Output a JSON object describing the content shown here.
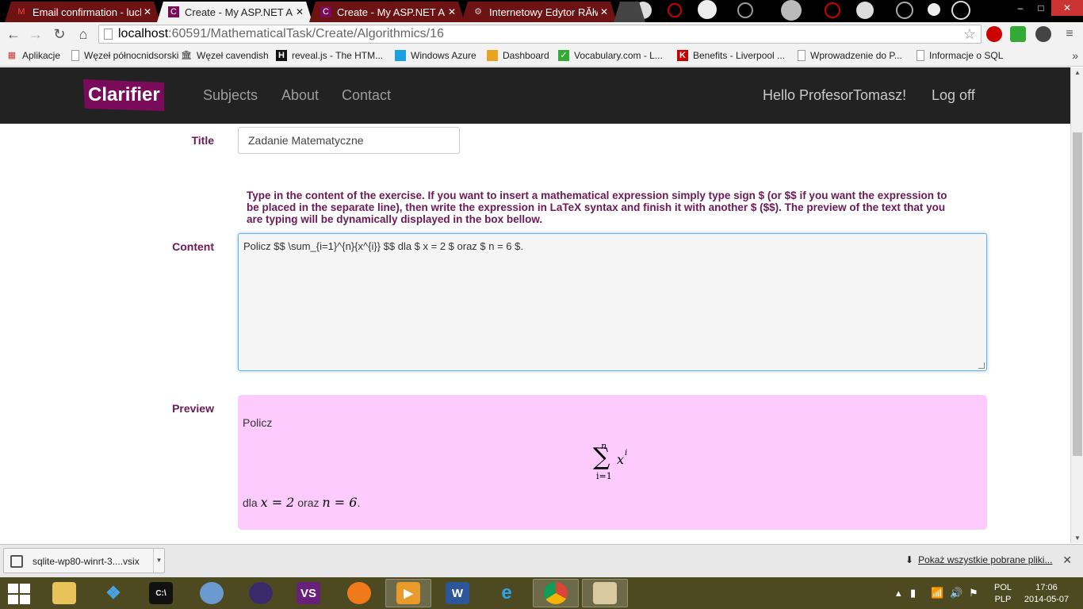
{
  "browser": {
    "tabs": [
      {
        "title": "Email confirmation - luck",
        "icon": "gmail-icon",
        "active": false
      },
      {
        "title": "Create - My ASP.NET App",
        "icon": "app-icon",
        "active": true
      },
      {
        "title": "Create - My ASP.NET App",
        "icon": "app-icon",
        "active": false
      },
      {
        "title": "Internetowy Edytor RĂłwn",
        "icon": "gear-icon",
        "active": false
      }
    ],
    "url_host": "localhost",
    "url_path": ":60591/MathematicalTask/Create/Algorithmics/16",
    "bookmarks": [
      {
        "label": "Aplikacje",
        "icon": "apps-grid-icon"
      },
      {
        "label": "Węzeł północnidsorski",
        "icon": "page-icon"
      },
      {
        "label": "Węzeł cavendish",
        "icon": "building-icon"
      },
      {
        "label": "reveal.js - The HTM...",
        "icon": "h-logo-icon"
      },
      {
        "label": "Windows Azure",
        "icon": "windows-icon"
      },
      {
        "label": "Dashboard",
        "icon": "dashboard-icon"
      },
      {
        "label": "Vocabulary.com - L...",
        "icon": "check-icon"
      },
      {
        "label": "Benefits - Liverpool ...",
        "icon": "k-logo-icon"
      },
      {
        "label": "Wprowadzenie do P...",
        "icon": "page-icon"
      },
      {
        "label": "Informacje o SQL",
        "icon": "page-icon"
      }
    ],
    "bookmarks_more": "»"
  },
  "app": {
    "logo_text": "Clarifier",
    "nav": {
      "subjects": "Subjects",
      "about": "About",
      "contact": "Contact",
      "greeting": "Hello ProfesorTomasz!",
      "logoff": "Log off"
    }
  },
  "form": {
    "title_label": "Title",
    "title_value": "Zadanie Matematyczne",
    "hint": "Type in the content of the exercise. If you want to insert a mathematical expression simply type sign $ (or $$ if you want the expression to be placed in the separate line), then write the expression in LaTeX syntax and finish it with another $ ($$). The preview of the text that you are typing will be dynamically displayed in the box bellow.",
    "content_label": "Content",
    "content_value": "Policz $$ \\sum_{i=1}^{n}{x^{i}} $$ dla $ x = 2 $ oraz $ n = 6 $.",
    "preview_label": "Preview",
    "preview": {
      "line1": "Policz",
      "formula_sum": "∑",
      "formula_upper": "n",
      "formula_lower": "i=1",
      "formula_base": "x",
      "formula_exp": "i",
      "line2_prefix": "dla",
      "eq1": "x = 2",
      "mid": "oraz",
      "eq2": "n = 6",
      "end": "."
    }
  },
  "downloads": {
    "file": "sqlite-wp80-winrt-3....vsix",
    "show_all": "Pokaż wszystkie pobrane pliki..."
  },
  "taskbar": {
    "apps": [
      "explorer-icon",
      "dropbox-icon",
      "cmd-icon",
      "finder-icon",
      "eclipse-icon",
      "visual-studio-icon",
      "avast-icon",
      "media-player-icon",
      "word-icon",
      "internet-explorer-icon",
      "chrome-icon",
      "paint-icon"
    ],
    "lang_1": "POL",
    "lang_2": "PLP",
    "time": "17:06",
    "date": "2014-05-07"
  },
  "colors": {
    "accent": "#6b1a55",
    "logo_bg": "#7a0b5a",
    "navbar_bg": "#222222",
    "preview_bg": "#fdcbfd"
  }
}
